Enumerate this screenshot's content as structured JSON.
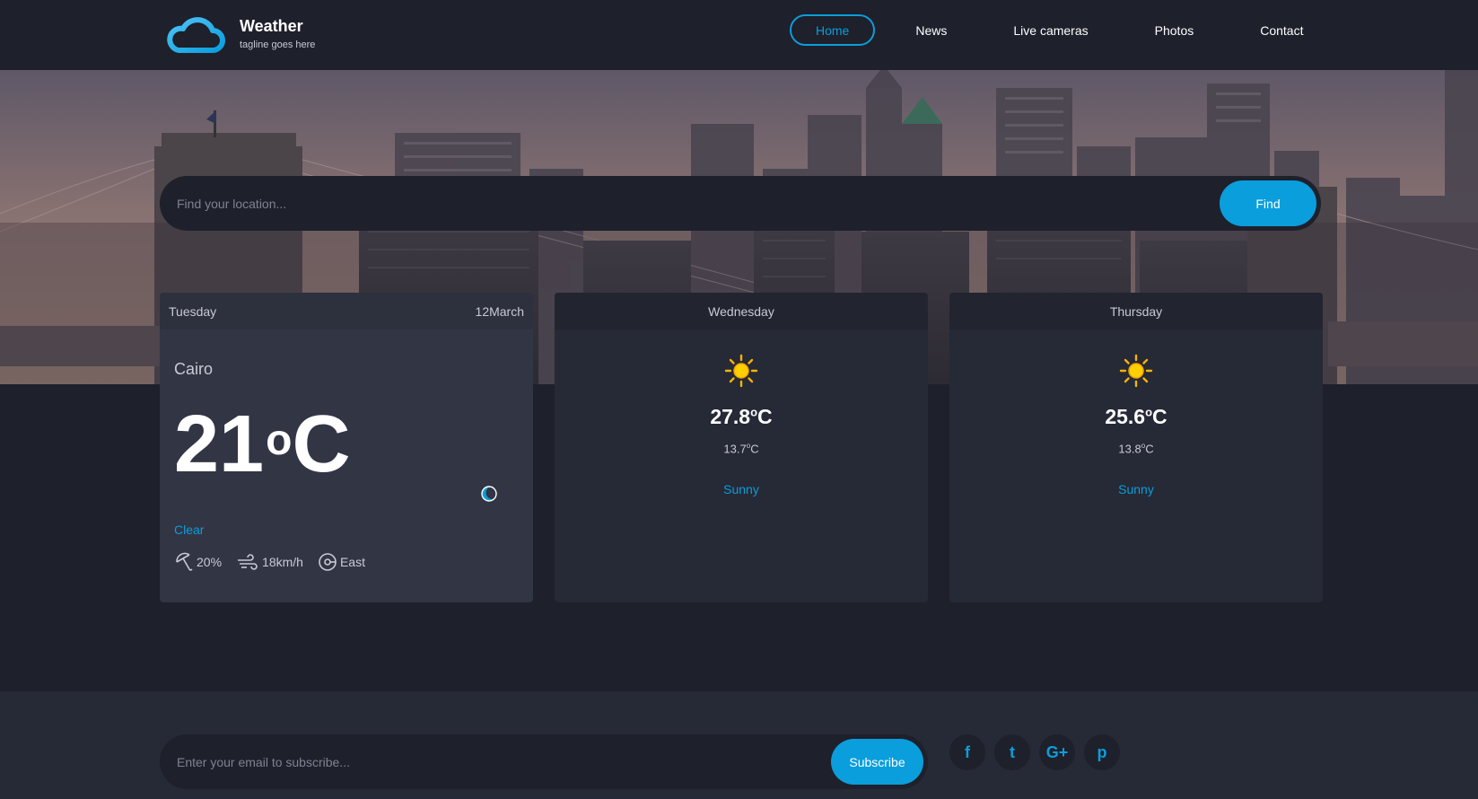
{
  "brand": {
    "title": "Weather",
    "tagline": "tagline goes here",
    "logo_icon": "cloud-icon"
  },
  "nav": {
    "items": [
      {
        "label": "Home",
        "active": true
      },
      {
        "label": "News",
        "active": false
      },
      {
        "label": "Live cameras",
        "active": false
      },
      {
        "label": "Photos",
        "active": false
      },
      {
        "label": "Contact",
        "active": false
      }
    ]
  },
  "search": {
    "placeholder": "Find your location...",
    "button_label": "Find"
  },
  "today": {
    "day": "Tuesday",
    "date": "12March",
    "location": "Cairo",
    "temp_value": "21",
    "temp_degree": "o",
    "temp_unit": "C",
    "condition": "Clear",
    "condition_icon": "moon-icon",
    "stats": {
      "humidity": "20%",
      "wind_speed": "18km/h",
      "wind_direction": "East"
    }
  },
  "forecast": [
    {
      "day": "Wednesday",
      "icon": "sun-icon",
      "max_value": "27.8",
      "max_unit": "C",
      "min_value": "13.7",
      "min_unit": "C",
      "degree": "o",
      "condition": "Sunny"
    },
    {
      "day": "Thursday",
      "icon": "sun-icon",
      "max_value": "25.6",
      "max_unit": "C",
      "min_value": "13.8",
      "min_unit": "C",
      "degree": "o",
      "condition": "Sunny"
    }
  ],
  "subscribe": {
    "placeholder": "Enter your email to subscribe...",
    "button_label": "Subscribe"
  },
  "social": [
    {
      "glyph": "f",
      "icon": "facebook-icon"
    },
    {
      "glyph": "t",
      "icon": "twitter-icon"
    },
    {
      "glyph": "G+",
      "icon": "google-plus-icon"
    },
    {
      "glyph": "p",
      "icon": "pinterest-icon"
    }
  ],
  "colors": {
    "accent": "#0a9edc",
    "background": "#1e202b",
    "card": "#323544",
    "card_secondary": "#262936",
    "muted_text": "#c8cad4"
  }
}
